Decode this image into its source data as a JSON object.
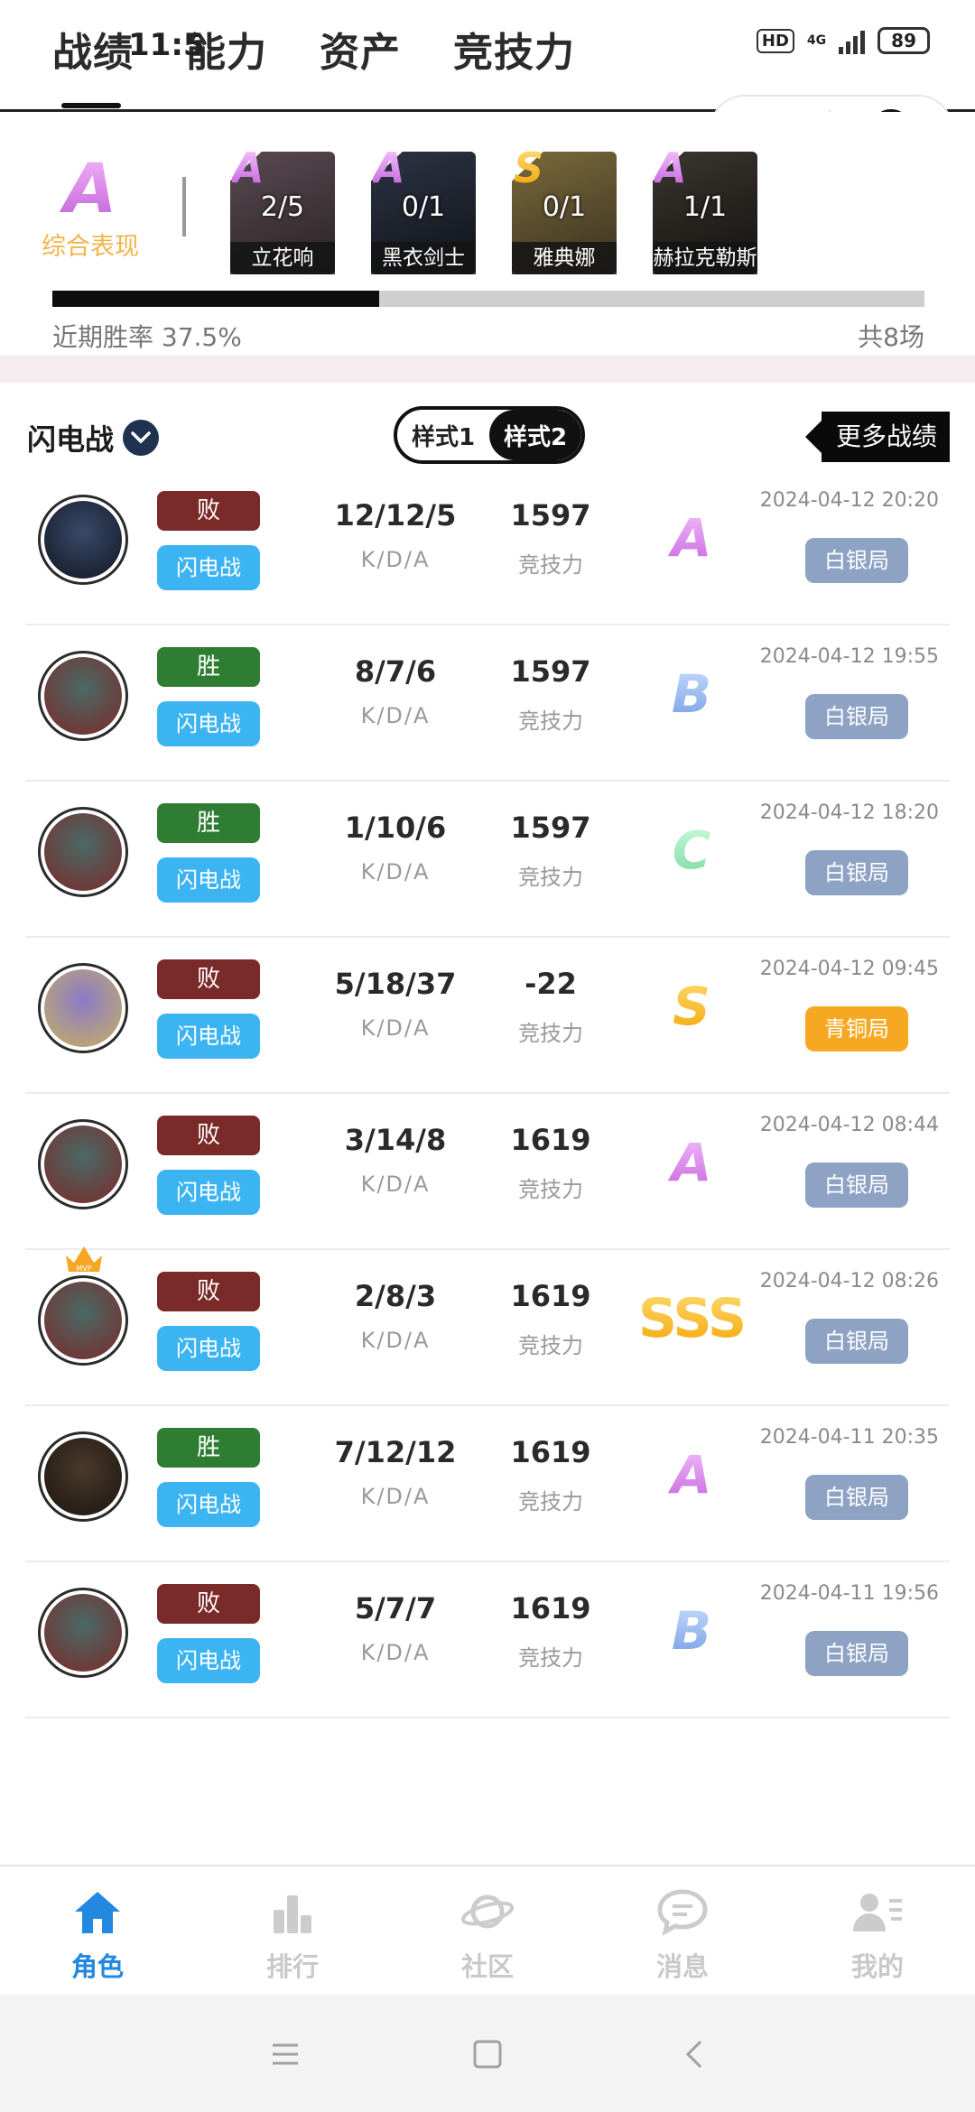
{
  "status_bar": {
    "time": "11:5",
    "hd": "HD",
    "network": "4G",
    "battery": "89"
  },
  "header": {
    "tabs": [
      "战绩",
      "能力",
      "资产",
      "竞技力"
    ],
    "active_tab": 0
  },
  "summary": {
    "overall_grade": "A",
    "overall_label": "综合表现",
    "heroes": [
      {
        "grade": "A",
        "score": "2/5",
        "name": "立花响",
        "colors": [
          "#5a4a52",
          "#2a2224"
        ]
      },
      {
        "grade": "A",
        "score": "0/1",
        "name": "黑衣剑士",
        "colors": [
          "#2c3444",
          "#101218"
        ]
      },
      {
        "grade": "S",
        "score": "0/1",
        "name": "雅典娜",
        "colors": [
          "#7a6a3a",
          "#3a3122"
        ]
      },
      {
        "grade": "A",
        "score": "1/1",
        "name": "赫拉克勒斯",
        "colors": [
          "#3a3630",
          "#141210"
        ]
      }
    ],
    "win_rate_label": "近期胜率 37.5%",
    "win_rate": 0.375,
    "total_label": "共8场"
  },
  "list_header": {
    "mode": "闪电战",
    "style1": "样式1",
    "style2": "样式2",
    "more": "更多战绩"
  },
  "kda_label": "K/D/A",
  "power_label": "竞技力",
  "matches": [
    {
      "result": "败",
      "win": false,
      "mode": "闪电战",
      "kda": "12/12/5",
      "power": "1597",
      "grade": "A",
      "time": "2024-04-12 20:20",
      "rank": "白银局",
      "rank_type": "silver",
      "avatar": [
        "#3a4a6a",
        "#111722"
      ],
      "mvp": false
    },
    {
      "result": "胜",
      "win": true,
      "mode": "闪电战",
      "kda": "8/7/6",
      "power": "1597",
      "grade": "B",
      "time": "2024-04-12 19:55",
      "rank": "白银局",
      "rank_type": "silver",
      "avatar": [
        "#4a6a66",
        "#7a2a2a"
      ],
      "mvp": false
    },
    {
      "result": "胜",
      "win": true,
      "mode": "闪电战",
      "kda": "1/10/6",
      "power": "1597",
      "grade": "C",
      "time": "2024-04-12 18:20",
      "rank": "白银局",
      "rank_type": "silver",
      "avatar": [
        "#4a6a66",
        "#7a2a2a"
      ],
      "mvp": false
    },
    {
      "result": "败",
      "win": false,
      "mode": "闪电战",
      "kda": "5/18/37",
      "power": "-22",
      "grade": "S",
      "time": "2024-04-12 09:45",
      "rank": "青铜局",
      "rank_type": "bronze",
      "avatar": [
        "#8a7ac8",
        "#c8b060"
      ],
      "mvp": false
    },
    {
      "result": "败",
      "win": false,
      "mode": "闪电战",
      "kda": "3/14/8",
      "power": "1619",
      "grade": "A",
      "time": "2024-04-12 08:44",
      "rank": "白银局",
      "rank_type": "silver",
      "avatar": [
        "#4a6a66",
        "#7a2a2a"
      ],
      "mvp": false
    },
    {
      "result": "败",
      "win": false,
      "mode": "闪电战",
      "kda": "2/8/3",
      "power": "1619",
      "grade": "SSS",
      "time": "2024-04-12 08:26",
      "rank": "白银局",
      "rank_type": "silver",
      "avatar": [
        "#4a6a66",
        "#7a2a2a"
      ],
      "mvp": true
    },
    {
      "result": "胜",
      "win": true,
      "mode": "闪电战",
      "kda": "7/12/12",
      "power": "1619",
      "grade": "A",
      "time": "2024-04-11 20:35",
      "rank": "白银局",
      "rank_type": "silver",
      "avatar": [
        "#4a3a2a",
        "#1a1410"
      ],
      "mvp": false
    },
    {
      "result": "败",
      "win": false,
      "mode": "闪电战",
      "kda": "5/7/7",
      "power": "1619",
      "grade": "B",
      "time": "2024-04-11 19:56",
      "rank": "白银局",
      "rank_type": "silver",
      "avatar": [
        "#4a6a66",
        "#7a2a2a"
      ],
      "mvp": false
    }
  ],
  "mvp_text": "MVP",
  "bottom_nav": {
    "items": [
      "角色",
      "排行",
      "社区",
      "消息",
      "我的"
    ],
    "icons": [
      "home-icon",
      "bar-chart-icon",
      "planet-icon",
      "chat-icon",
      "user-list-icon"
    ],
    "active": 0
  },
  "colors": {
    "accent": "#2288e0",
    "lose": "#7b2a2a",
    "win": "#2e7d32",
    "mode": "#3db4f2",
    "silver": "#8ea2c4",
    "bronze": "#f7a823"
  }
}
